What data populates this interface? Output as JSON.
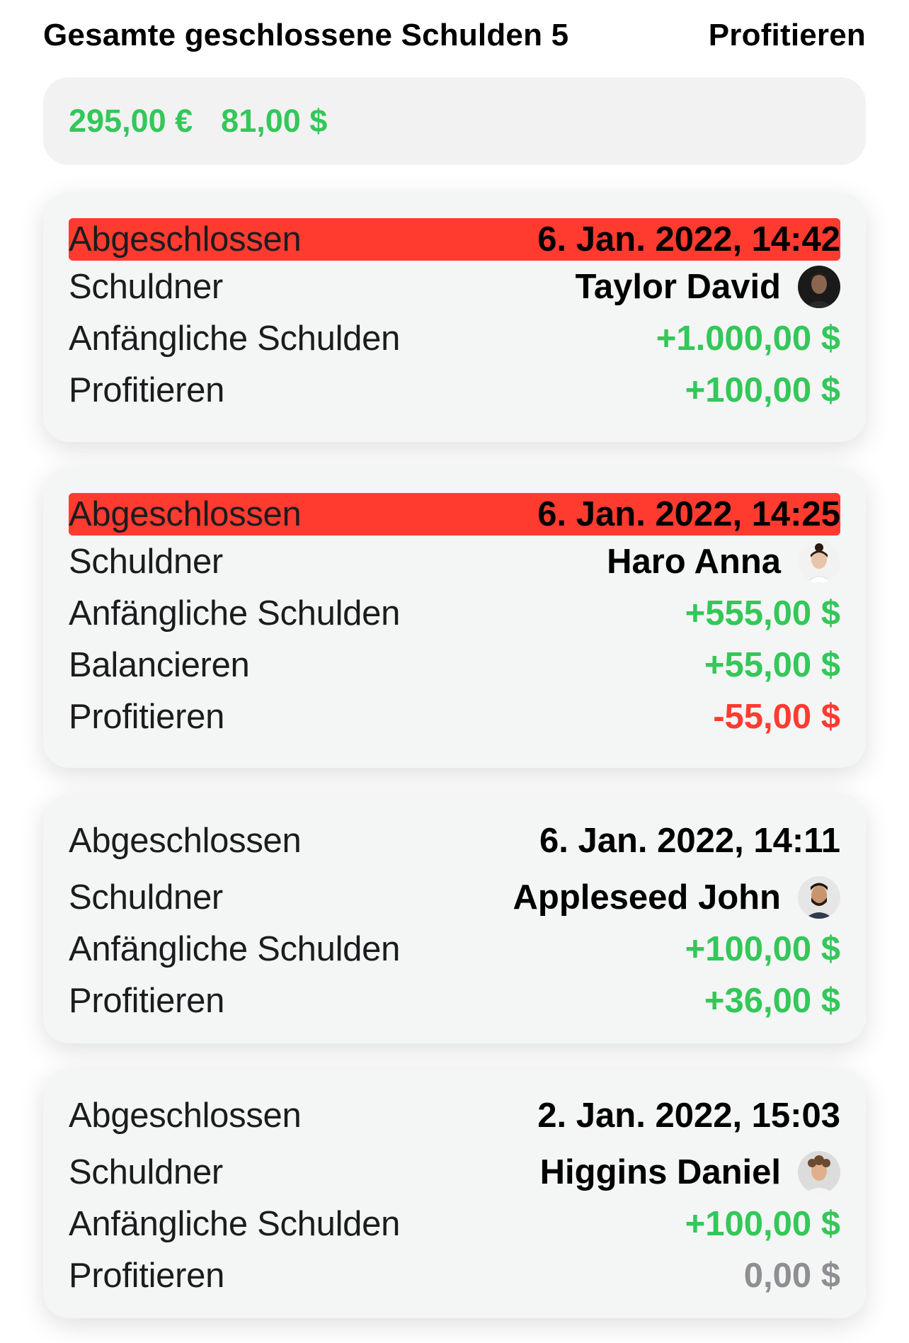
{
  "header": {
    "title": "Gesamte geschlossene Schulden 5",
    "right_label": "Profitieren"
  },
  "summary": {
    "eur": "295,00 €",
    "usd": "81,00 $"
  },
  "colors": {
    "positive": "#34c759",
    "negative": "#ff3b30",
    "neutral": "#8e8e93",
    "highlight": "#ff3b30"
  },
  "debts": [
    {
      "closed_label": "Abgeschlossen",
      "closed_date": "6. Jan. 2022, 14:42",
      "highlighted": true,
      "debtor_label": "Schuldner",
      "debtor_name": "Taylor David",
      "avatar_icon": "man-dark-portrait-avatar",
      "initial_label": "Anfängliche Schulden",
      "initial_value": "+1.000,00 $",
      "profit_label": "Profitieren",
      "profit_value": "+100,00 $"
    },
    {
      "closed_label": "Abgeschlossen",
      "closed_date": "6. Jan. 2022, 14:25",
      "highlighted": true,
      "debtor_label": "Schuldner",
      "debtor_name": "Haro Anna",
      "avatar_icon": "woman-portrait-avatar",
      "initial_label": "Anfängliche Schulden",
      "initial_value": "+555,00 $",
      "balance_label": "Balancieren",
      "balance_value": "+55,00 $",
      "profit_label": "Profitieren",
      "profit_value": "-55,00 $"
    },
    {
      "closed_label": "Abgeschlossen",
      "closed_date": "6. Jan. 2022, 14:11",
      "highlighted": false,
      "debtor_label": "Schuldner",
      "debtor_name": "Appleseed John",
      "avatar_icon": "man-beard-portrait-avatar",
      "initial_label": "Anfängliche Schulden",
      "initial_value": "+100,00 $",
      "profit_label": "Profitieren",
      "profit_value": "+36,00 $"
    },
    {
      "closed_label": "Abgeschlossen",
      "closed_date": "2. Jan. 2022, 15:03",
      "highlighted": false,
      "debtor_label": "Schuldner",
      "debtor_name": "Higgins Daniel",
      "avatar_icon": "man-curly-portrait-avatar",
      "initial_label": "Anfängliche Schulden",
      "initial_value": "+100,00 $",
      "profit_label": "Profitieren",
      "profit_value": "0,00 $"
    }
  ]
}
